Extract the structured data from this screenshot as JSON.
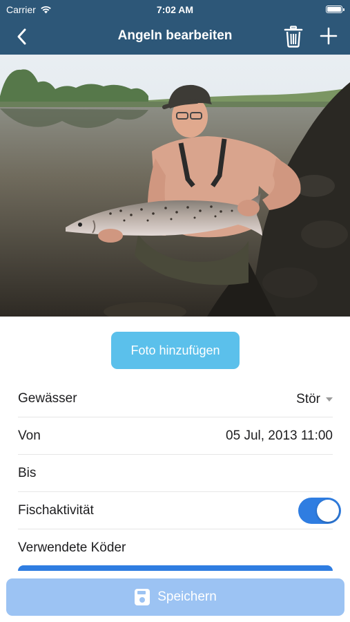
{
  "status_bar": {
    "carrier": "Carrier",
    "time": "7:02 AM"
  },
  "nav": {
    "title": "Angeln bearbeiten",
    "back_icon": "chevron-left-icon",
    "delete_icon": "trash-icon",
    "add_icon": "plus-icon"
  },
  "photo": {
    "description_icon": "catch-photo"
  },
  "add_photo_button": {
    "label": "Foto hinzufügen"
  },
  "form": {
    "water": {
      "label": "Gewässer",
      "value": "Stör"
    },
    "from": {
      "label": "Von",
      "value": "05 Jul, 2013 11:00"
    },
    "to": {
      "label": "Bis",
      "value": ""
    },
    "fish_activity": {
      "label": "Fischaktivität",
      "enabled": true
    },
    "bait": {
      "label": "Verwendete Köder"
    }
  },
  "save_button": {
    "label": "Speichern",
    "icon": "save-icon"
  },
  "colors": {
    "nav_bg": "#2d5778",
    "accent_blue": "#2f7de1",
    "photo_button": "#5bc0eb",
    "save_button": "#9cc3f3"
  }
}
